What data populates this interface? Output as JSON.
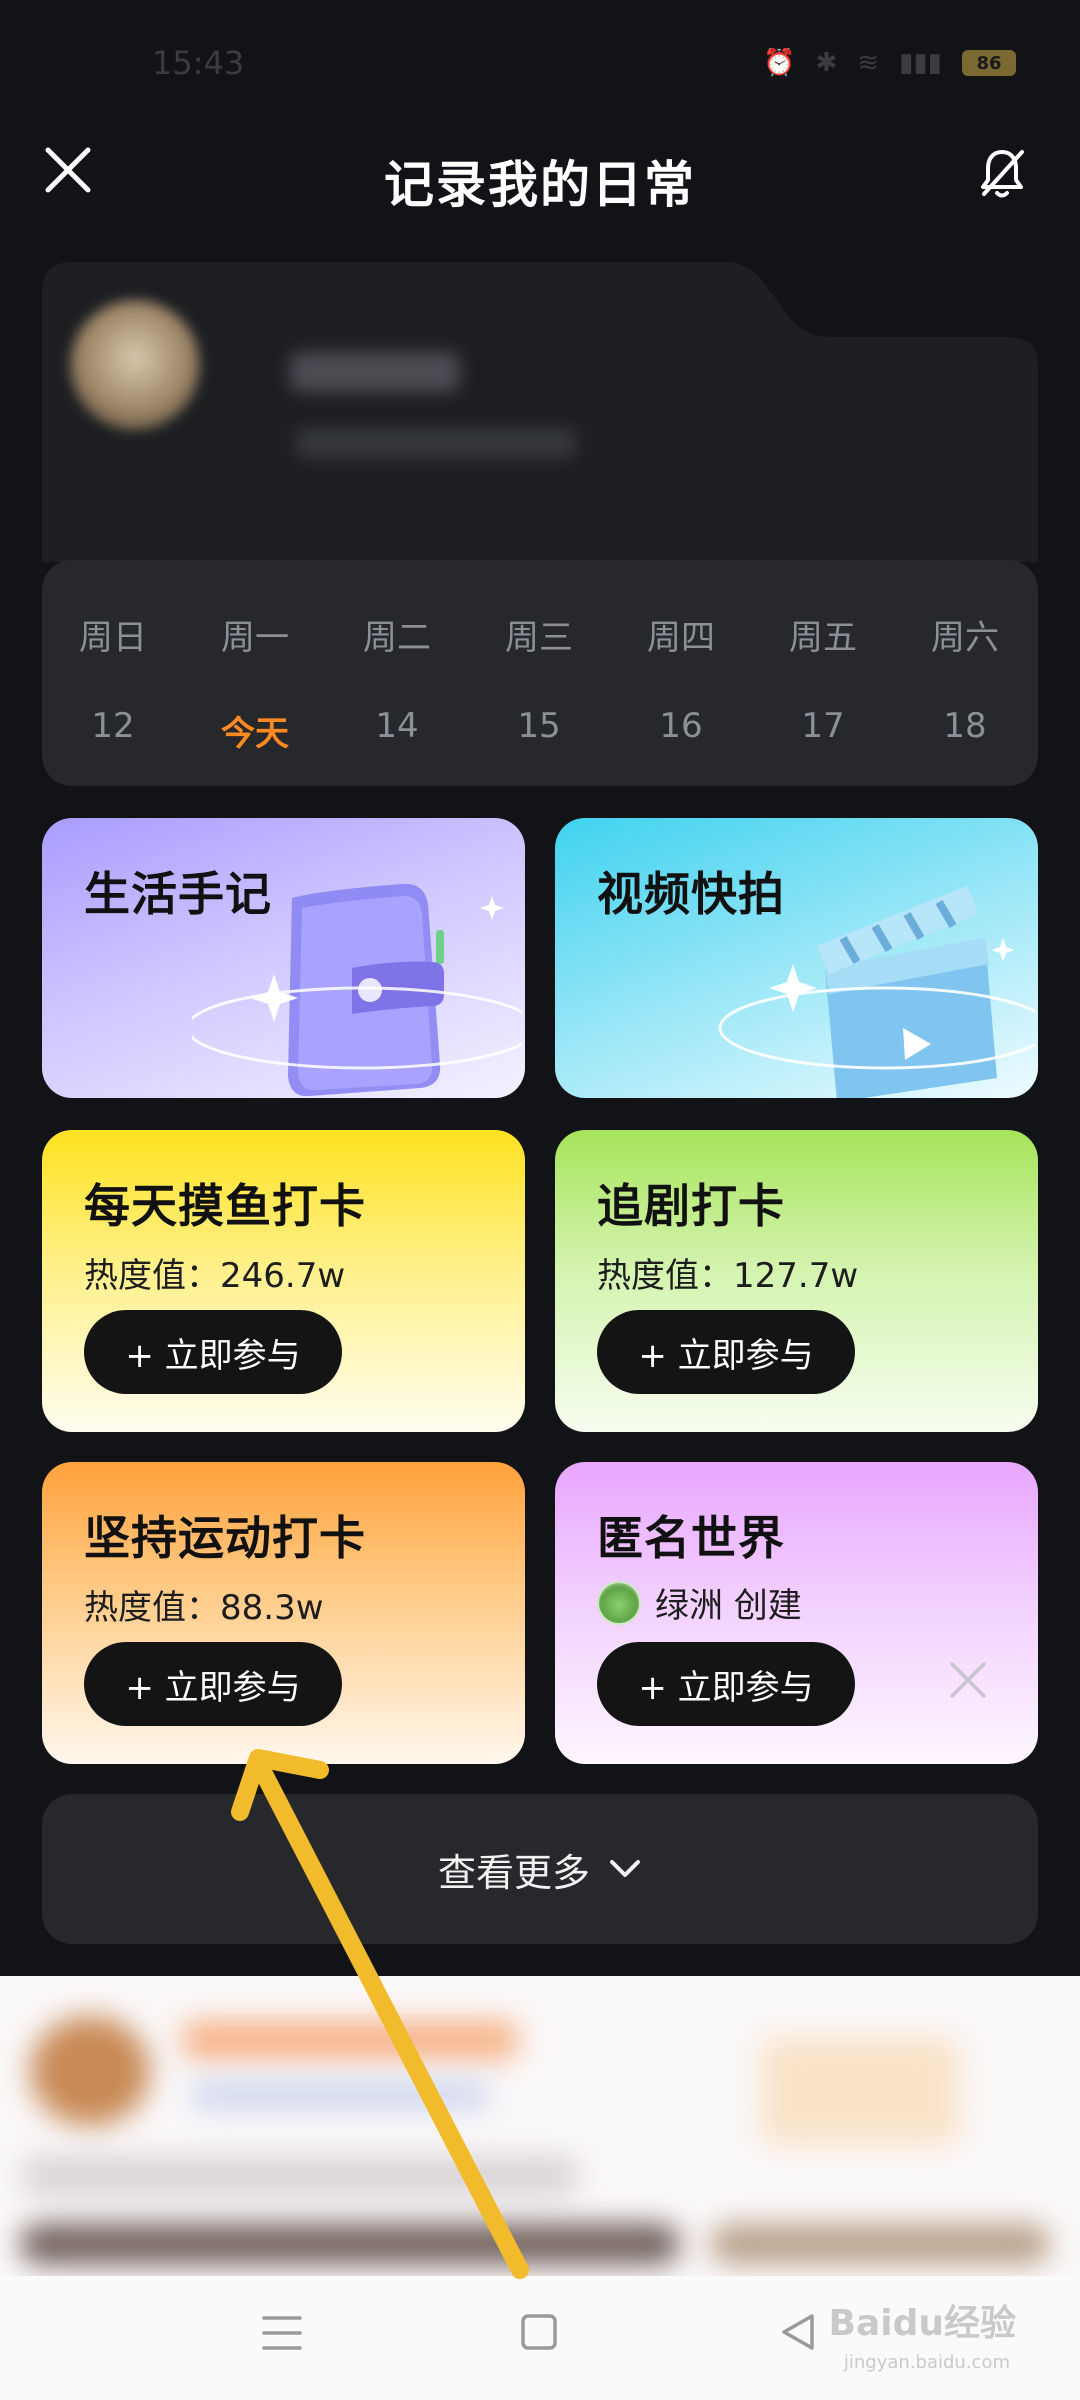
{
  "status_bar": {
    "time": "15:43",
    "battery": "86"
  },
  "header": {
    "title": "记录我的日常"
  },
  "calendar": {
    "days": [
      {
        "label": "周日",
        "date": "12"
      },
      {
        "label": "周一",
        "date": "今天"
      },
      {
        "label": "周二",
        "date": "14"
      },
      {
        "label": "周三",
        "date": "15"
      },
      {
        "label": "周四",
        "date": "16"
      },
      {
        "label": "周五",
        "date": "17"
      },
      {
        "label": "周六",
        "date": "18"
      }
    ],
    "today_color": "#ff8a1f"
  },
  "cards": {
    "life_notes": {
      "title": "生活手记",
      "icon": "wallet-icon"
    },
    "video_snap": {
      "title": "视频快拍",
      "icon": "clapperboard-icon"
    },
    "fish": {
      "title": "每天摸鱼打卡",
      "heat": "热度值：246.7w",
      "button": "+ 立即参与"
    },
    "drama": {
      "title": "追剧打卡",
      "heat": "热度值：127.7w",
      "button": "+ 立即参与"
    },
    "sport": {
      "title": "坚持运动打卡",
      "heat": "热度值：88.3w",
      "button": "+ 立即参与"
    },
    "anon": {
      "title": "匿名世界",
      "creator": "绿洲 创建",
      "button": "+ 立即参与"
    }
  },
  "see_more": {
    "label": "查看更多"
  },
  "watermark": {
    "text": "Baidu经验",
    "sub": "jingyan.baidu.com"
  },
  "colors": {
    "background": "#121316",
    "card_dark": "#26282c",
    "annotation": "#f2bb2c"
  }
}
